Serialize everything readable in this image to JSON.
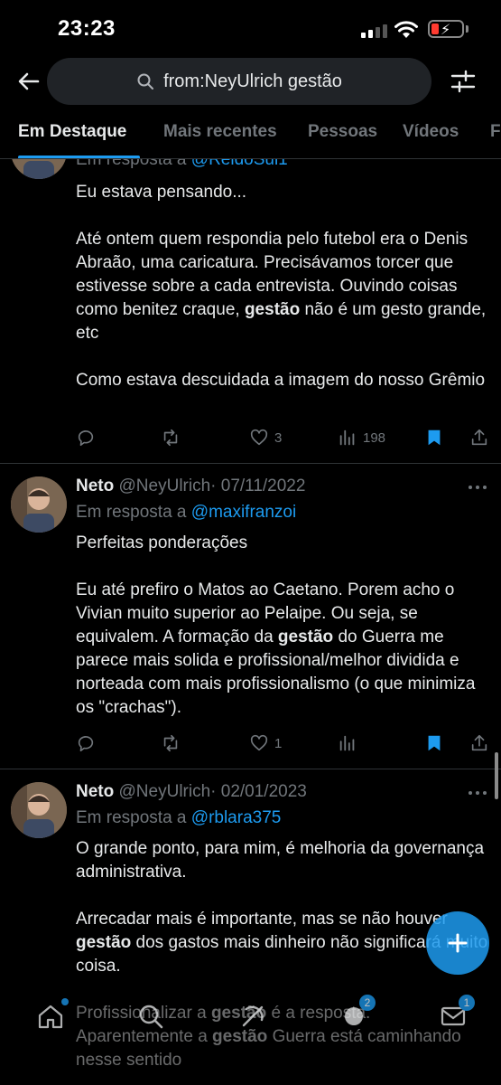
{
  "status_bar": {
    "time": "23:23"
  },
  "search": {
    "query": "from:NeyUlrich gestão"
  },
  "tabs": [
    {
      "label": "Em Destaque"
    },
    {
      "label": "Mais recentes"
    },
    {
      "label": "Pessoas"
    },
    {
      "label": "Vídeos"
    },
    {
      "label": "F"
    }
  ],
  "tweets": [
    {
      "reply_prefix": "Em resposta a ",
      "reply_to": "@ReidoSul1",
      "body": [
        [
          "Eu estava pensando..."
        ],
        [],
        [
          "Até ontem quem respondia pelo futebol era o Denis Abraão, uma caricatura. Precisávamos torcer que estivesse sobre a cada entrevista. Ouvindo coisas como benitez craque, ",
          {
            "b": "gestão"
          },
          " não é um gesto grande, etc"
        ],
        [],
        [
          "Como estava descuidada a imagem do nosso Grêmio"
        ]
      ],
      "likes": "3",
      "views": "198"
    },
    {
      "name": "Neto",
      "handle": "@NeyUlrich",
      "date": "· 07/11/2022",
      "reply_prefix": "Em resposta a ",
      "reply_to": "@maxifranzoi",
      "body": [
        [
          "Perfeitas ponderações"
        ],
        [],
        [
          "Eu até prefiro o Matos ao Caetano. Porem acho o Vivian muito superior ao Pelaipe. Ou seja, se equivalem. A formação da ",
          {
            "b": "gestão"
          },
          " do Guerra me parece mais solida e profissional/melhor dividida e norteada com mais profissionalismo (o que minimiza os \"crachas\")."
        ]
      ],
      "likes": "1",
      "views": ""
    },
    {
      "name": "Neto",
      "handle": "@NeyUlrich",
      "date": "· 02/01/2023",
      "reply_prefix": "Em resposta a ",
      "reply_to": "@rblara375",
      "body": [
        [
          "O grande ponto, para mim, é melhoria da governança administrativa."
        ],
        [],
        [
          "Arrecadar mais é importante, mas se não houver ",
          {
            "b": "gestão"
          },
          " dos gastos mais dinheiro não significará muito coisa."
        ],
        [],
        [
          "Profissionalizar a ",
          {
            "b": "gestão"
          },
          " é a resposta. Aparentemente a ",
          {
            "b": "gestão"
          },
          " Guerra está caminhando nesse sentido"
        ]
      ]
    }
  ],
  "bottom_nav": {
    "communities_badge": "2",
    "messages_badge": "1"
  },
  "colors": {
    "accent": "#1d9bf0",
    "muted": "#71767b",
    "text": "#e7e9ea",
    "background": "#000000"
  }
}
